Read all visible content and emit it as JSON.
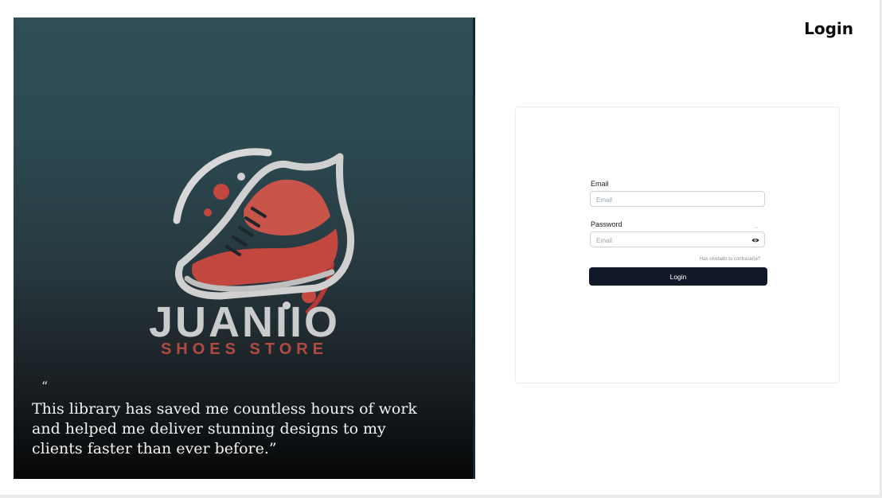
{
  "page": {
    "title": "Login"
  },
  "hero": {
    "brand_name": "JUANIIO",
    "brand_subtitle": "SHOES STORE",
    "quote_mark": "“",
    "quote": "This library has saved me countless hours of work and helped me deliver stunning designs to my clients faster than ever before.”"
  },
  "login_form": {
    "email_label": "Email",
    "email_placeholder": "Email",
    "password_label": "Password",
    "password_placeholder": "Email",
    "password_toggle_icon": "eye-icon",
    "forgot_password": "Has olvidado tu contraseña?",
    "submit_label": "Login"
  },
  "colors": {
    "primary_button": "#111827",
    "brand_red": "#b24a42",
    "hero_top": "#2f4e56",
    "hero_bottom": "#060708"
  }
}
